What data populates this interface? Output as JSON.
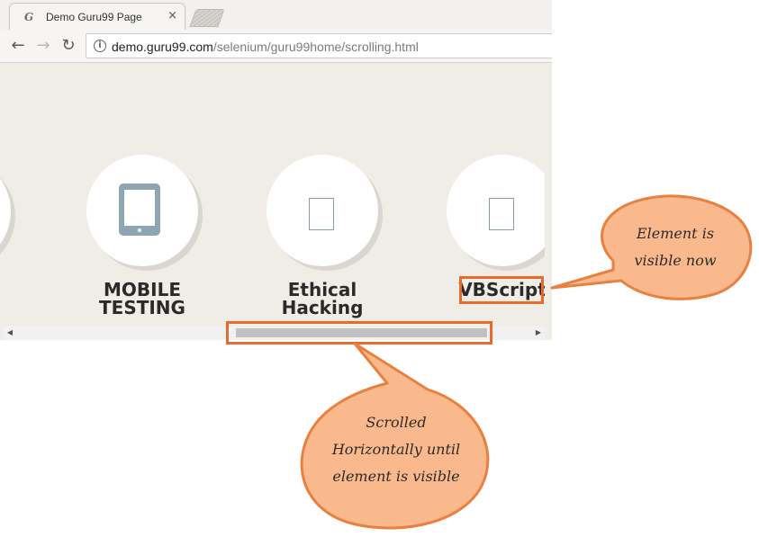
{
  "browser": {
    "tab": {
      "title": "Demo Guru99 Page",
      "icon": "guru99-favicon-icon",
      "close": "×"
    },
    "toolbar": {
      "back": "←",
      "forward": "→",
      "reload": "↻",
      "info": "i",
      "url_host": "demo.guru99.com",
      "url_path": "/selenium/guru99home/scrolling.html"
    }
  },
  "page": {
    "cards": [
      {
        "label_line1": "MOBILE",
        "label_line2": "TESTING",
        "icon": "tablet-icon"
      },
      {
        "label_line1": "Ethical",
        "label_line2": "Hacking",
        "icon": "broken-image-icon"
      },
      {
        "label": "VBScript",
        "icon": "broken-image-icon"
      }
    ]
  },
  "scrollbar": {
    "left_arrow": "◀",
    "right_arrow": "▶"
  },
  "annotations": {
    "visible_callout": {
      "line1": "Element is",
      "line2": "visible now"
    },
    "scroll_callout": {
      "line1": "Scrolled",
      "line2": "Horizontally until",
      "line3": "element is visible"
    },
    "colors": {
      "highlight": "#e86a2c",
      "bubble_fill": "#f9b98c",
      "bubble_stroke": "#e8803f"
    }
  }
}
